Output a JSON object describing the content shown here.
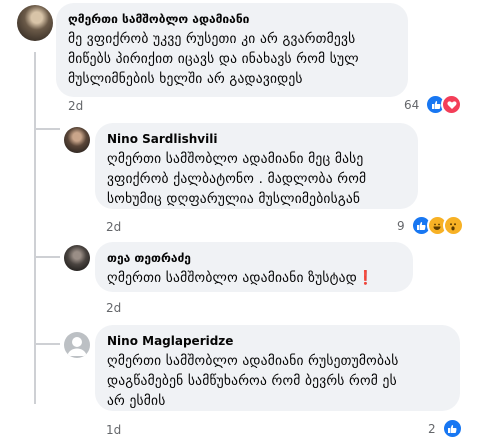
{
  "comments": [
    {
      "author": "ღმერთი სამშობლო ადამიანი",
      "text": "მე ვფიქრობ უკვე რუსეთი კი არ გვართმევს\nმიწებს პირიქით იცავს და ინახავს რომ სულ\nმუსლიმნების ხელში არ გადავიდეს",
      "age": "2d",
      "reaction_count": "64",
      "reactions": [
        "like-icon",
        "love-icon"
      ]
    },
    {
      "author": "Nino Sardlishvili",
      "text": "ღმერთი სამშობლო ადამიანი მეც მასე\nვფიქრობ ქალბატონო . მადლობა რომ\nსოხუმიც დღფარულია მუსლიმებისგან",
      "age": "2d",
      "reaction_count": "9",
      "reactions": [
        "like-icon",
        "haha-icon",
        "wow-icon"
      ]
    },
    {
      "author": "თეა თეთრაძე",
      "text": "ღმერთი სამშობლო ადამიანი ზუსტად",
      "emoji": "❗",
      "age": "2d"
    },
    {
      "author": "Nino Maglaperidze",
      "text": "ღმერთი სამშობლო ადამიანი რუსეთუმობას\nდაგწამებენ სამწუხაროა რომ ბევრს რომ ეს\nარ ესმის",
      "age": "1d",
      "reaction_count": "2",
      "reactions": [
        "like-icon"
      ]
    }
  ],
  "colors": {
    "like": "#1877f2",
    "love": "#f33e58",
    "haha": "#f7b125"
  }
}
